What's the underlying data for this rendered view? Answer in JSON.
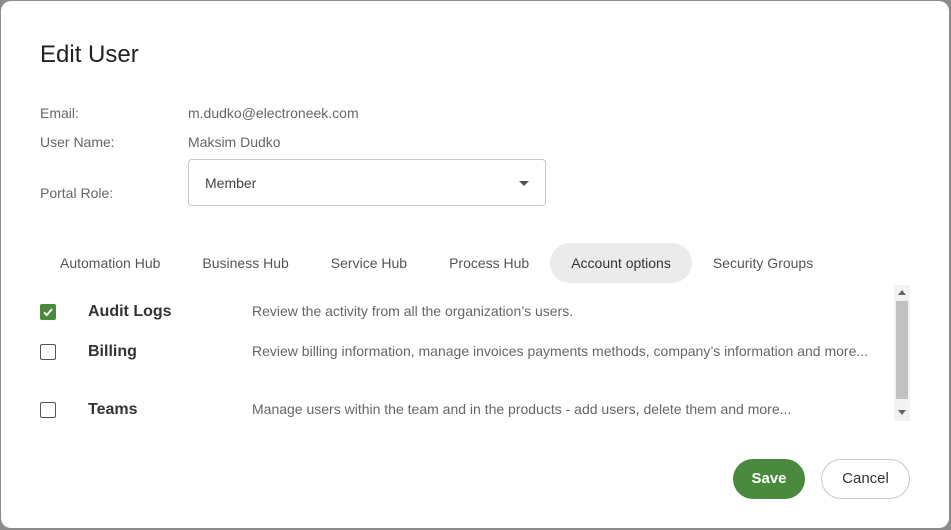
{
  "dialog": {
    "title": "Edit User",
    "fields": {
      "email_label": "Email:",
      "email_value": "m.dudko@electroneek.com",
      "username_label": "User Name:",
      "username_value": "Maksim Dudko",
      "role_label": "Portal Role:",
      "role_selected": "Member"
    },
    "tabs": [
      {
        "label": "Automation Hub",
        "active": false
      },
      {
        "label": "Business Hub",
        "active": false
      },
      {
        "label": "Service Hub",
        "active": false
      },
      {
        "label": "Process Hub",
        "active": false
      },
      {
        "label": "Account options",
        "active": true
      },
      {
        "label": "Security Groups",
        "active": false
      }
    ],
    "permissions": [
      {
        "name": "Audit Logs",
        "description": "Review the activity from all the organization’s users.",
        "checked": true
      },
      {
        "name": "Billing",
        "description": "Review billing information, manage invoices payments methods, company’s information and more...",
        "checked": false
      },
      {
        "name": "Teams",
        "description": "Manage users within the team and in the products - add users, delete them and more...",
        "checked": false
      }
    ],
    "buttons": {
      "save_label": "Save",
      "cancel_label": "Cancel"
    },
    "colors": {
      "accent": "#4a8a3e",
      "active_tab_bg": "#ebebeb"
    }
  }
}
